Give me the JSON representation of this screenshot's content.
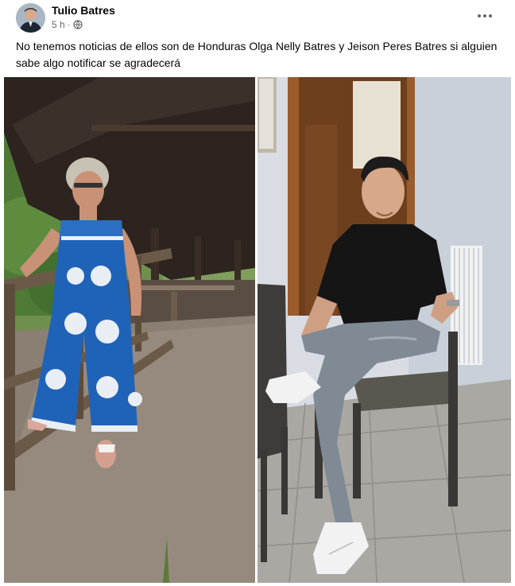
{
  "post": {
    "author": "Tulio Batres",
    "time": "5 h",
    "separator": "·",
    "privacy_icon": "globe-icon",
    "menu_icon": "more-options-icon",
    "text": "No tenemos noticias de ellos son de Honduras Olga Nelly Batres y Jeison Peres Batres si alguien sabe algo notificar se agradecerá"
  },
  "colors": {
    "secondary_text": "#65676b",
    "primary_text": "#050505",
    "dress_blue": "#1f63b8"
  }
}
